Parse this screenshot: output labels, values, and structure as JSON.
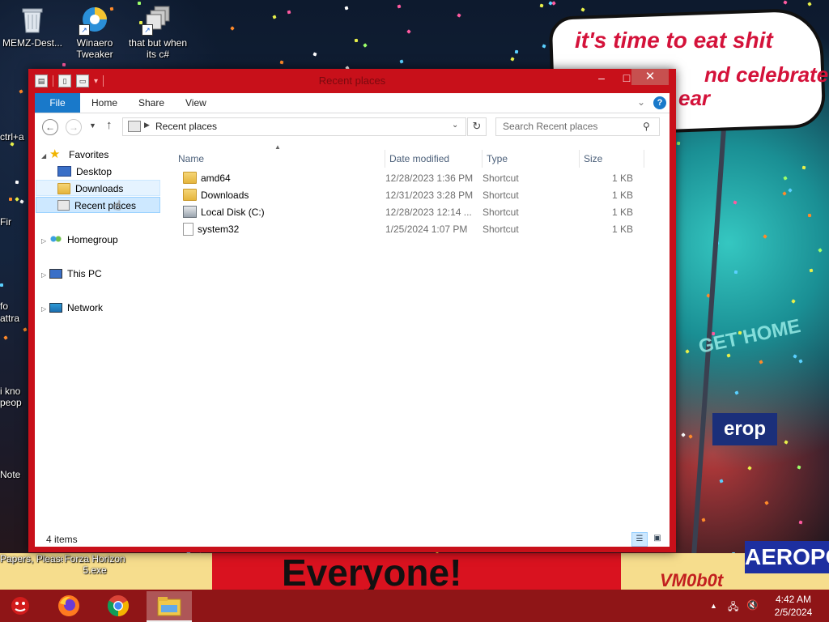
{
  "desktop": {
    "icons": [
      {
        "label": "MEMZ-Dest...",
        "icon": "recycle-bin-icon"
      },
      {
        "label": "Winaero Tweaker",
        "icon": "winaero-icon"
      },
      {
        "label": "that but when its c#",
        "icon": "stacked-windows-icon"
      }
    ],
    "side_stubs": [
      "ctrl+a",
      "Fir",
      "fo",
      "attra",
      "i kno",
      "peop",
      "Note"
    ],
    "bottom_icons": [
      {
        "label": "Papers, Please"
      },
      {
        "label": "Forza Horizon 5.exe"
      }
    ],
    "wallpaper_text": {
      "line1": "it's time to eat shit",
      "line2": "nd celebrate",
      "line3": "ear",
      "get_home": "GET HOME",
      "aerop1": "erop",
      "everyone": "Everyone!",
      "aerop2": "AEROPOS",
      "vm": "VM0b0t"
    }
  },
  "window": {
    "title": "Recent places",
    "controls": {
      "minimize": "–",
      "maximize": "□",
      "close": "✕"
    },
    "ribbon": {
      "file": "File",
      "tabs": [
        "Home",
        "Share",
        "View"
      ],
      "help": "?"
    },
    "address": {
      "path": "Recent places",
      "search_placeholder": "Search Recent places"
    },
    "nav_pane": {
      "favorites": "Favorites",
      "favorites_items": [
        "Desktop",
        "Downloads",
        "Recent places"
      ],
      "homegroup": "Homegroup",
      "this_pc": "This PC",
      "network": "Network"
    },
    "columns": {
      "name": "Name",
      "date": "Date modified",
      "type": "Type",
      "size": "Size"
    },
    "files": [
      {
        "name": "amd64",
        "date": "12/28/2023 1:36 PM",
        "type": "Shortcut",
        "size": "1 KB",
        "icon": "folder"
      },
      {
        "name": "Downloads",
        "date": "12/31/2023 3:28 PM",
        "type": "Shortcut",
        "size": "1 KB",
        "icon": "folder"
      },
      {
        "name": "Local Disk (C:)",
        "date": "12/28/2023 12:14 ...",
        "type": "Shortcut",
        "size": "1 KB",
        "icon": "disk"
      },
      {
        "name": "system32",
        "date": "1/25/2024 1:07 PM",
        "type": "Shortcut",
        "size": "1 KB",
        "icon": "blank"
      }
    ],
    "status": {
      "item_count": "4 items"
    }
  },
  "taskbar": {
    "apps": [
      "memz-app-icon",
      "firefox-icon",
      "chrome-icon",
      "file-explorer-icon"
    ],
    "clock": {
      "time": "4:42 AM",
      "date": "2/5/2024"
    }
  },
  "colors": {
    "window_frame": "#c8101a",
    "taskbar": "#8f1517",
    "accent": "#1979ca"
  }
}
